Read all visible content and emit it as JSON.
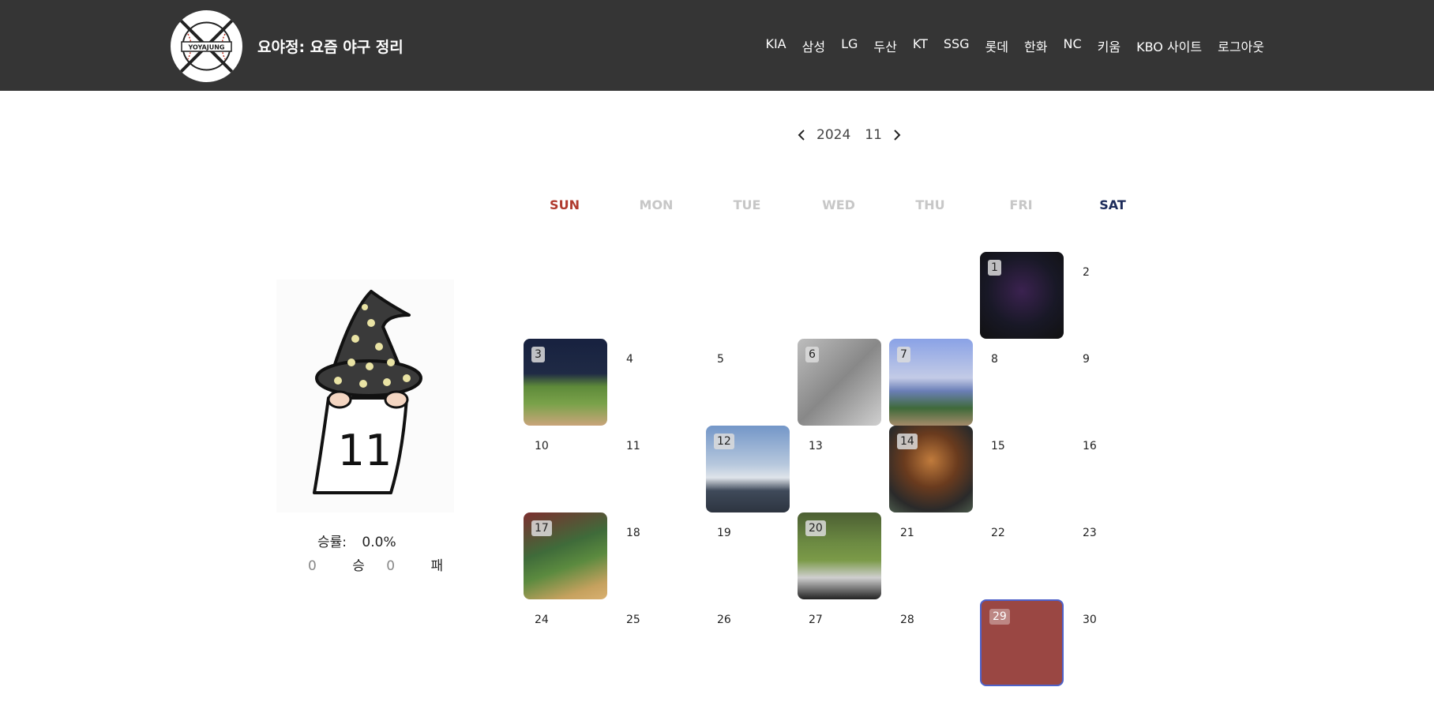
{
  "header": {
    "site_title": "요야정: 요즘 야구 정리",
    "logo_text": "YOYAJUNG",
    "nav": [
      "KIA",
      "삼성",
      "LG",
      "두산",
      "KT",
      "SSG",
      "롯데",
      "한화",
      "NC",
      "키움",
      "KBO 사이트",
      "로그아웃"
    ]
  },
  "month_nav": {
    "year": "2024",
    "month": "11"
  },
  "mascot": {
    "month_label": "11"
  },
  "stats": {
    "rate_label": "승률:",
    "rate_value": "0.0%",
    "wins": "0",
    "win_label": "승",
    "losses": "0",
    "loss_label": "패"
  },
  "calendar": {
    "weekdays": [
      "SUN",
      "MON",
      "TUE",
      "WED",
      "THU",
      "FRI",
      "SAT"
    ],
    "days": [
      "1",
      "2",
      "3",
      "4",
      "5",
      "6",
      "7",
      "8",
      "9",
      "10",
      "11",
      "12",
      "13",
      "14",
      "15",
      "16",
      "17",
      "18",
      "19",
      "20",
      "21",
      "22",
      "23",
      "24",
      "25",
      "26",
      "27",
      "28",
      "29",
      "30"
    ],
    "photo_days": [
      "1",
      "3",
      "6",
      "7",
      "12",
      "14",
      "17",
      "20"
    ],
    "today": "29"
  },
  "colors": {
    "header_bg": "#353535",
    "sunday": "#b03a2e",
    "saturday": "#1c2b5a",
    "weekday_muted": "#c7c7c7",
    "today_fill": "#9a4743",
    "today_border": "#4f62c9"
  }
}
